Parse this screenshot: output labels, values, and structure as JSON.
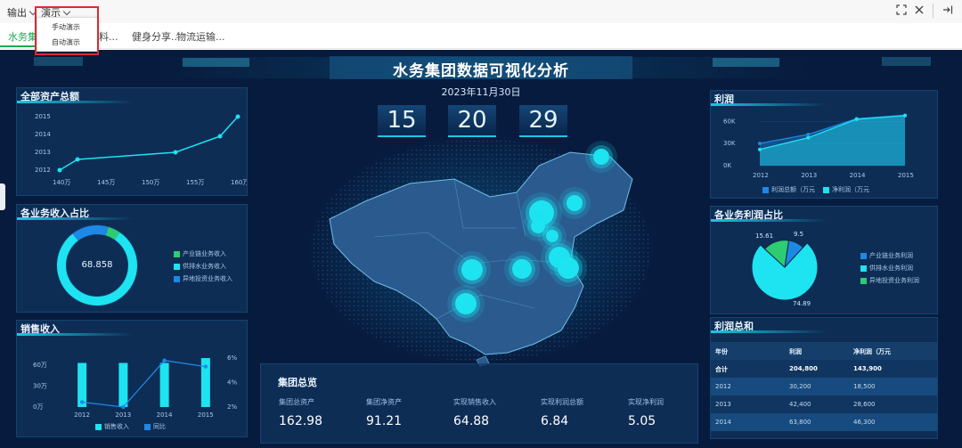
{
  "toolbar": {
    "output_label": "输出",
    "present_label": "演示"
  },
  "dropdown": {
    "items": [
      "手动演示",
      "自动演示"
    ]
  },
  "tabs": [
    {
      "label": "水务集团"
    },
    {
      "label": "料..."
    },
    {
      "label": "健身分享..."
    },
    {
      "label": "物流运输..."
    }
  ],
  "dashboard": {
    "title": "水务集团数据可视化分析",
    "date": "2023年11月30日",
    "clock": [
      "15",
      "20",
      "29"
    ],
    "panels": {
      "total_assets": "全部资产总额",
      "revenue_share": "各业务收入占比",
      "sales": "销售收入",
      "profit": "利润",
      "profit_share": "各业务利润占比",
      "profit_total": "利润总和",
      "overview": "集团总览"
    },
    "revenue_share": {
      "center_value": "68.858",
      "legend": [
        "产业链业务收入",
        "供排水业务收入",
        "异地投资业务收入"
      ]
    },
    "profit_share": {
      "legend": [
        "产业链业务利润",
        "供排水业务利润",
        "异地投资业务利润"
      ],
      "labels": [
        "15.61",
        "9.5",
        "74.89"
      ]
    },
    "profit_table": {
      "headers": [
        "年份",
        "利润",
        "净利润（万元"
      ],
      "rows": [
        [
          "合计",
          "204,800",
          "143,900"
        ],
        [
          "2012",
          "30,200",
          "18,500"
        ],
        [
          "2013",
          "42,400",
          "28,600"
        ],
        [
          "2014",
          "63,800",
          "46,300"
        ]
      ]
    },
    "overview": {
      "labels": [
        "集团总资产",
        "集团净资产",
        "实现销售收入",
        "实现利润总额",
        "实现净利润"
      ],
      "values": [
        "162.98",
        "91.21",
        "64.88",
        "6.84",
        "5.05"
      ]
    }
  },
  "colors": {
    "accent": "#1ac8e6",
    "bg": "#071b3e",
    "blue": "#1e88e5",
    "green": "#2ecc71"
  },
  "chart_data": [
    {
      "type": "line",
      "title": "全部资产总额",
      "x_ticks": [
        "140万",
        "145万",
        "150万",
        "155万",
        "160万"
      ],
      "y_ticks": [
        "2012",
        "2013",
        "2014",
        "2015"
      ],
      "points": [
        [
          140,
          2012.0
        ],
        [
          142,
          2012.6
        ],
        [
          153,
          2013.0
        ],
        [
          158,
          2013.9
        ],
        [
          160,
          2015.0
        ]
      ],
      "xlim": [
        140,
        160
      ],
      "ylim": [
        2012,
        2015
      ]
    },
    {
      "type": "pie",
      "title": "各业务收入占比",
      "series": [
        {
          "name": "产业链业务收入",
          "value": 5
        },
        {
          "name": "供排水业务收入",
          "value": 80
        },
        {
          "name": "异地投资业务收入",
          "value": 15
        }
      ]
    },
    {
      "type": "bar",
      "title": "销售收入",
      "categories": [
        "2012",
        "2013",
        "2014",
        "2015"
      ],
      "y_ticks": [
        "0万",
        "30万",
        "60万"
      ],
      "y2_ticks": [
        "2%",
        "4%",
        "6%"
      ],
      "series": [
        {
          "name": "销售收入",
          "values": [
            63,
            63,
            63,
            70
          ]
        },
        {
          "name": "同比",
          "values": [
            2.4,
            2.0,
            5.8,
            5.3
          ]
        }
      ],
      "ylim": [
        0,
        70
      ],
      "y2lim": [
        2,
        6
      ]
    },
    {
      "type": "area",
      "title": "利润",
      "categories": [
        "2012",
        "2013",
        "2014",
        "2015"
      ],
      "y_ticks": [
        "0K",
        "30K",
        "60K"
      ],
      "series": [
        {
          "name": "利润总额（万元",
          "values": [
            30.2,
            42.4,
            63.8,
            68.4
          ]
        },
        {
          "name": "净利润（万元",
          "values": [
            22,
            38,
            63,
            68
          ]
        }
      ],
      "ylim": [
        0,
        75
      ]
    },
    {
      "type": "pie",
      "title": "各业务利润占比",
      "series": [
        {
          "name": "产业链业务利润",
          "value": 9.5
        },
        {
          "name": "供排水业务利润",
          "value": 74.89
        },
        {
          "name": "异地投资业务利润",
          "value": 15.61
        }
      ]
    }
  ]
}
